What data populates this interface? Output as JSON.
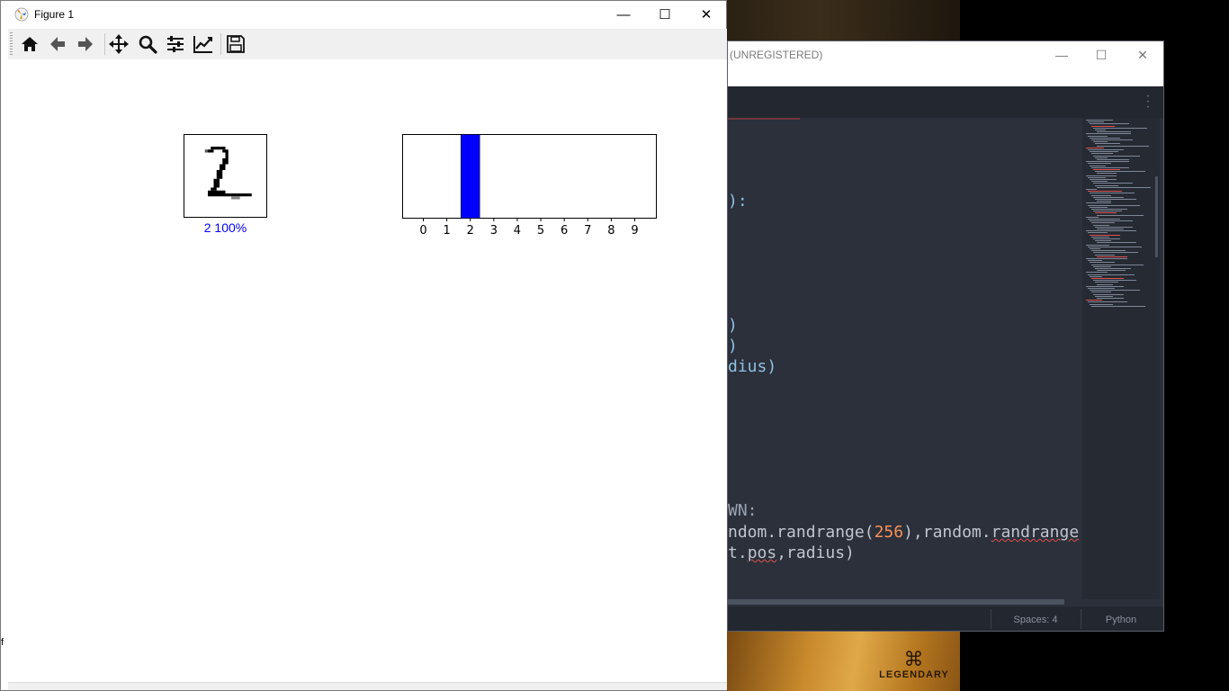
{
  "figure_window": {
    "title": "Figure 1",
    "controls": {
      "minimize": "—",
      "maximize": "☐",
      "close": "✕"
    },
    "toolbar": [
      "home-icon",
      "back-icon",
      "forward-icon",
      "pan-icon",
      "zoom-icon",
      "configure-subplots-icon",
      "edit-axis-icon",
      "save-icon"
    ],
    "digit_caption": "2 100%",
    "caption_color": "#0000ff",
    "stray_left": "f"
  },
  "chart_data": {
    "type": "bar",
    "categories": [
      "0",
      "1",
      "2",
      "3",
      "4",
      "5",
      "6",
      "7",
      "8",
      "9"
    ],
    "values": [
      0,
      0,
      1,
      0,
      0,
      0,
      0,
      0,
      0,
      0
    ],
    "ylim": [
      0,
      1
    ],
    "bar_color": "#0000ff",
    "xticks": [
      "0",
      "1",
      "2",
      "3",
      "4",
      "5",
      "6",
      "7",
      "8",
      "9"
    ]
  },
  "editor_window": {
    "title_suffix": "(UNREGISTERED)",
    "code_lines": [
      {
        "id": "l1",
        "parts": [
          {
            "t": "):",
            "c": "paren"
          }
        ]
      },
      {
        "id": "l2",
        "parts": [
          {
            "t": ")",
            "c": "paren"
          }
        ]
      },
      {
        "id": "l3",
        "parts": [
          {
            "t": ")",
            "c": "paren"
          }
        ]
      },
      {
        "id": "l4",
        "parts": [
          {
            "t": "dius)",
            "c": "paren"
          }
        ]
      },
      {
        "id": "l5",
        "parts": [
          {
            "t": "WN:",
            "c": "dim"
          }
        ]
      },
      {
        "id": "l6",
        "parts": [
          {
            "t": "ndom.randrange(",
            "c": ""
          },
          {
            "t": "256",
            "c": "num"
          },
          {
            "t": "),random.",
            "c": ""
          },
          {
            "t": "randrange",
            "c": "squig"
          }
        ]
      },
      {
        "id": "l7",
        "parts": [
          {
            "t": "t.",
            "c": ""
          },
          {
            "t": "pos",
            "c": "squig"
          },
          {
            "t": ",radius)",
            "c": ""
          }
        ]
      }
    ],
    "status": {
      "spaces": "Spaces: 4",
      "syntax": "Python"
    }
  },
  "wallpaper": {
    "brand": "LEGENDARY"
  }
}
